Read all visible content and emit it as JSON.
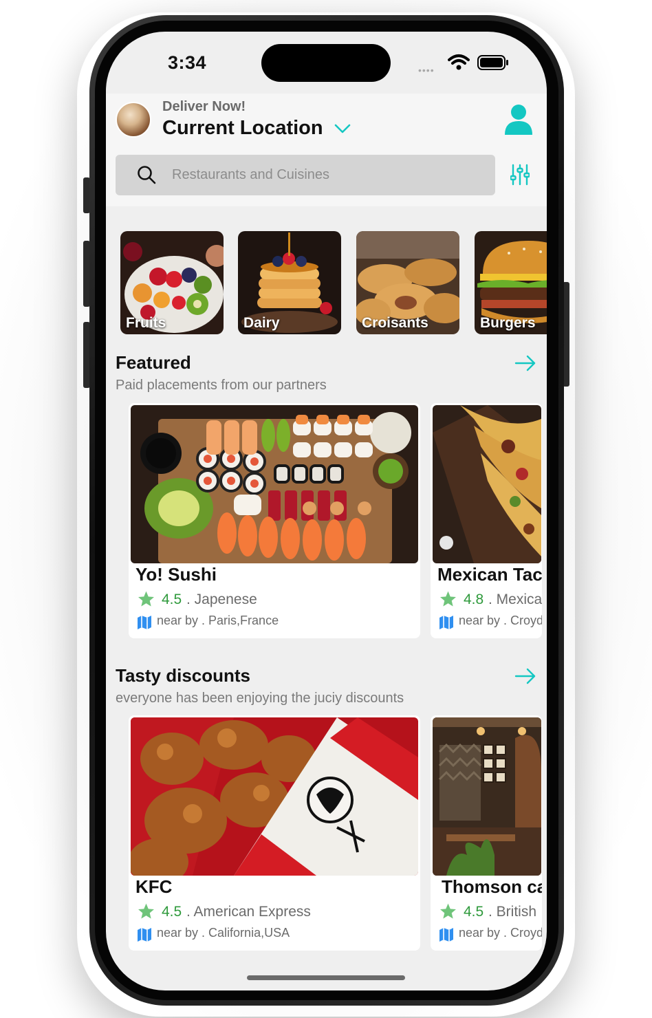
{
  "status_bar": {
    "time": "3:34",
    "signal_dots": "••••"
  },
  "header": {
    "deliver_label": "Deliver Now!",
    "location_label": "Current Location"
  },
  "search": {
    "placeholder": "Restaurants and Cuisines"
  },
  "categories": [
    {
      "label": "Fruits"
    },
    {
      "label": "Dairy"
    },
    {
      "label": "Croisants"
    },
    {
      "label": "Burgers"
    }
  ],
  "featured": {
    "title": "Featured",
    "subtitle": "Paid placements from our partners",
    "cards": [
      {
        "name": "Yo! Sushi",
        "rating": "4.5",
        "cuisine": ". Japenese",
        "nearby": "near by . Paris,France"
      },
      {
        "name": "Mexican Tacos",
        "rating": "4.8",
        "cuisine": ". Mexican",
        "nearby": "near by . Croydon"
      }
    ]
  },
  "discounts": {
    "title": "Tasty discounts",
    "subtitle": "everyone has been enjoying the juciy discounts",
    "cards": [
      {
        "name": "KFC",
        "rating": "4.5",
        "cuisine": ". American Express",
        "nearby": "near by . California,USA"
      },
      {
        "name": "Thomson cafe",
        "rating": "4.5",
        "cuisine": ". British",
        "nearby": "near by . Croydon"
      }
    ]
  },
  "colors": {
    "accent": "#14c7c2",
    "rating_green": "#2f9a3c",
    "star_green": "#6fc47a",
    "map_blue": "#2f8ff0"
  }
}
